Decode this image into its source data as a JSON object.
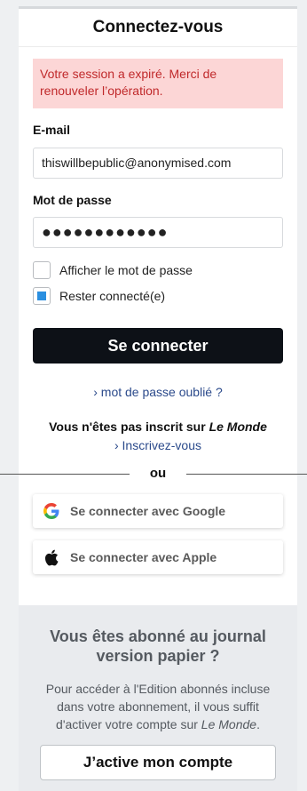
{
  "login": {
    "title": "Connectez-vous",
    "alert_line1": "Votre session a expiré. Merci de",
    "alert_line2": "renouveler l’opération.",
    "email_label": "E-mail",
    "email_value": "thiswillbepublic@anonymised.com",
    "password_label": "Mot de passe",
    "password_mask": "●●●●●●●●●●●●",
    "show_password_label": "Afficher le mot de passe",
    "show_password_checked": false,
    "stay_connected_label": "Rester connecté(e)",
    "stay_connected_checked": true,
    "submit_label": "Se connecter",
    "forgot_link": "› mot de passe oublié ?",
    "not_registered_prefix": "Vous n'êtes pas inscrit sur ",
    "not_registered_brand": "Le Monde",
    "register_link": "› Inscrivez-vous",
    "divider_word": "ou",
    "google_button": "Se connecter avec Google",
    "apple_button": "Se connecter avec Apple"
  },
  "promo": {
    "title_line1": "Vous êtes abonné au journal",
    "title_line2": "version papier ?",
    "text_line1": "Pour accéder à l'Edition abonnés incluse",
    "text_line2": "dans votre abonnement, il vous suffit",
    "text_line3_prefix": "d'activer votre compte sur ",
    "text_line3_brand": "Le Monde",
    "text_line3_suffix": ".",
    "button_label": "J’active mon compte"
  },
  "colors": {
    "alert_bg": "#fcd6d6",
    "alert_text": "#c0292b",
    "primary_button": "#0d1117",
    "link": "#2b4a8b",
    "checkbox_accent": "#2a8fe0"
  },
  "icons": {
    "google": "google-g-logo-icon",
    "apple": "apple-logo-icon"
  }
}
